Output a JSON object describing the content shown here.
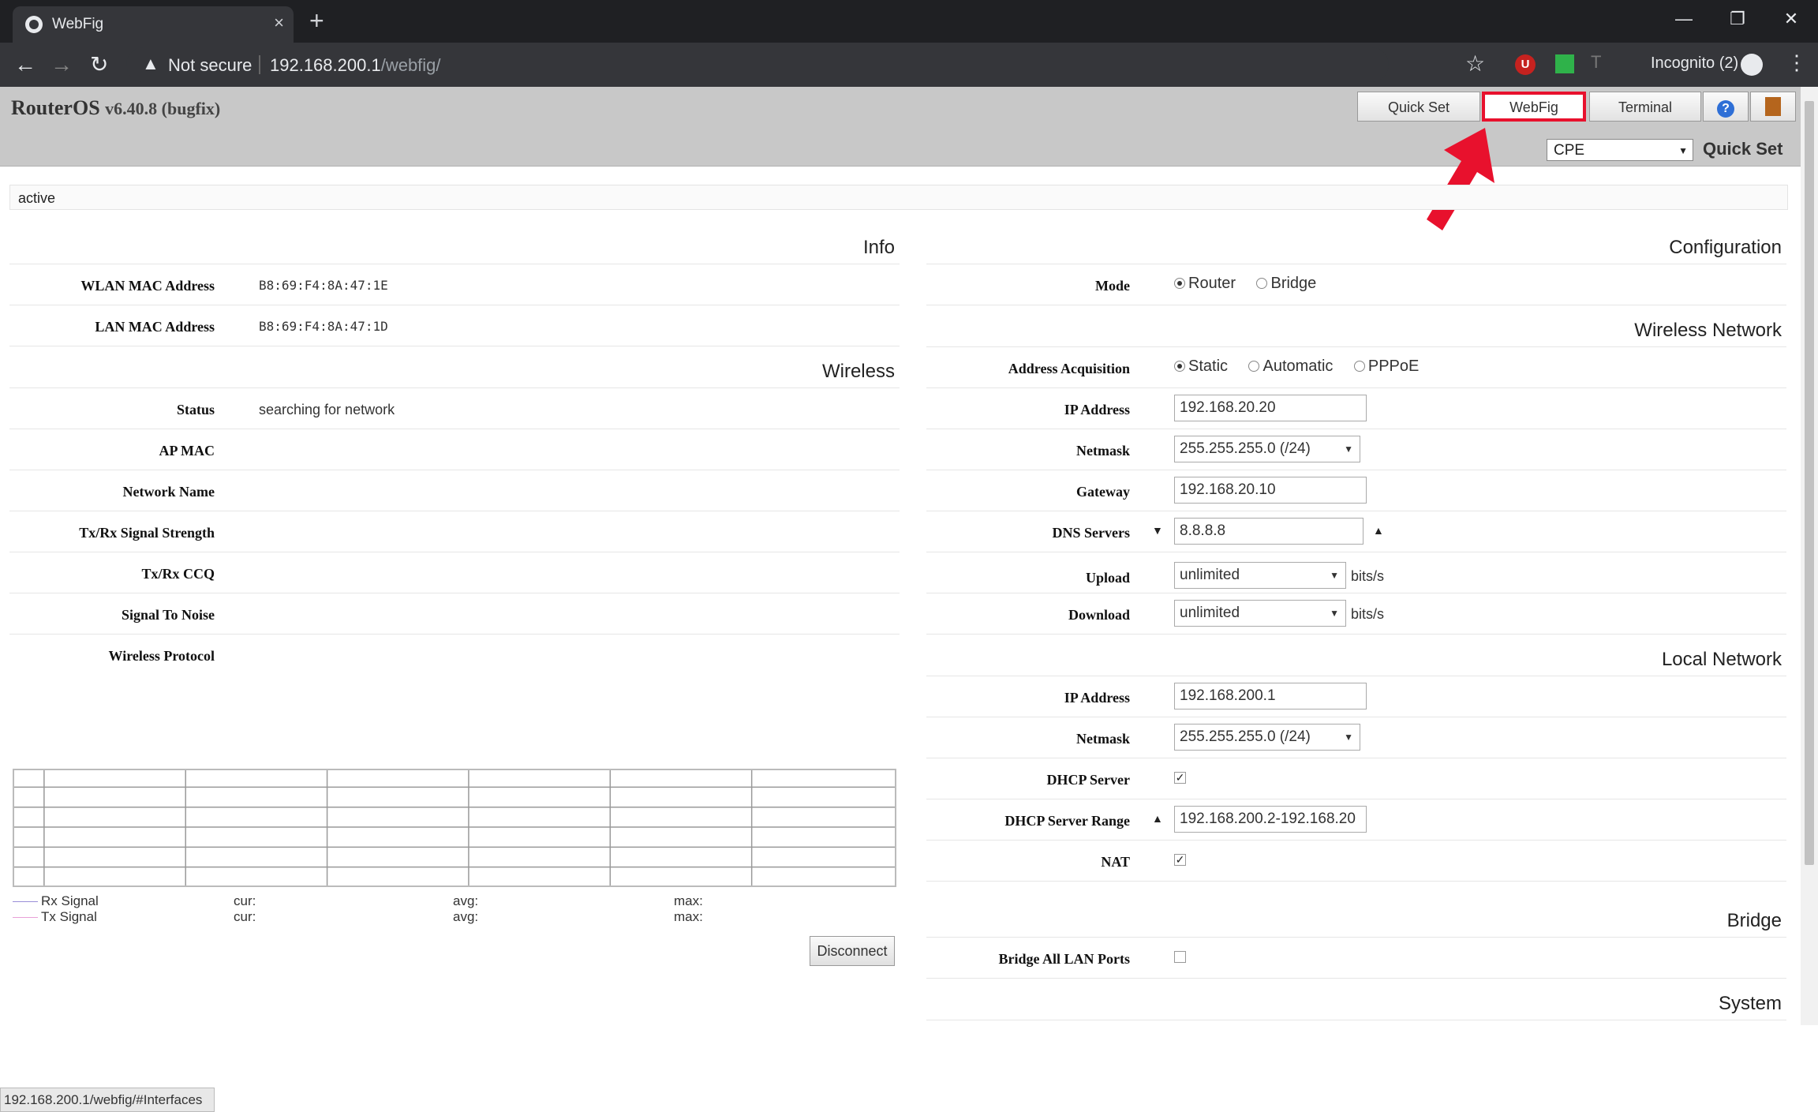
{
  "browser": {
    "tab_title": "WebFig",
    "security_label": "Not secure",
    "url_host": "192.168.200.1",
    "url_path": "/webfig/",
    "incognito_label": "Incognito (2)"
  },
  "header": {
    "product": "RouterOS",
    "version": "v6.40.8 (bugfix)",
    "buttons": {
      "quickset": "Quick Set",
      "webfig": "WebFig",
      "terminal": "Terminal"
    },
    "mode_select": "CPE",
    "mode_label": "Quick Set"
  },
  "status_text": "active",
  "info": {
    "title": "Info",
    "wlan_mac_label": "WLAN MAC Address",
    "wlan_mac": "B8:69:F4:8A:47:1E",
    "lan_mac_label": "LAN MAC Address",
    "lan_mac": "B8:69:F4:8A:47:1D"
  },
  "wireless": {
    "title": "Wireless",
    "status_label": "Status",
    "status": "searching for network",
    "ap_mac_label": "AP MAC",
    "network_name_label": "Network Name",
    "signal_strength_label": "Tx/Rx Signal Strength",
    "ccq_label": "Tx/Rx CCQ",
    "snr_label": "Signal To Noise",
    "protocol_label": "Wireless Protocol"
  },
  "graph": {
    "rx_label": "Rx Signal",
    "tx_label": "Tx Signal",
    "cur": "cur:",
    "avg": "avg:",
    "max": "max:",
    "rx_color": "#9a8fd8",
    "tx_color": "#e8a0d8"
  },
  "disconnect_label": "Disconnect",
  "configuration": {
    "title": "Configuration",
    "mode_label": "Mode",
    "mode_router": "Router",
    "mode_bridge": "Bridge"
  },
  "wireless_network": {
    "title": "Wireless Network",
    "acq_label": "Address Acquisition",
    "acq_static": "Static",
    "acq_auto": "Automatic",
    "acq_pppoe": "PPPoE",
    "ip_label": "IP Address",
    "ip": "192.168.20.20",
    "netmask_label": "Netmask",
    "netmask": "255.255.255.0 (/24)",
    "gateway_label": "Gateway",
    "gateway": "192.168.20.10",
    "dns_label": "DNS Servers",
    "dns": "8.8.8.8",
    "upload_label": "Upload",
    "upload": "unlimited",
    "download_label": "Download",
    "download": "unlimited",
    "unit": "bits/s"
  },
  "local_network": {
    "title": "Local Network",
    "ip_label": "IP Address",
    "ip": "192.168.200.1",
    "netmask_label": "Netmask",
    "netmask": "255.255.255.0 (/24)",
    "dhcp_label": "DHCP Server",
    "dhcp_range_label": "DHCP Server Range",
    "dhcp_range": "192.168.200.2-192.168.20",
    "nat_label": "NAT"
  },
  "bridge": {
    "title": "Bridge",
    "all_ports_label": "Bridge All LAN Ports"
  },
  "system": {
    "title": "System"
  },
  "status_bar_url": "192.168.200.1/webfig/#Interfaces"
}
